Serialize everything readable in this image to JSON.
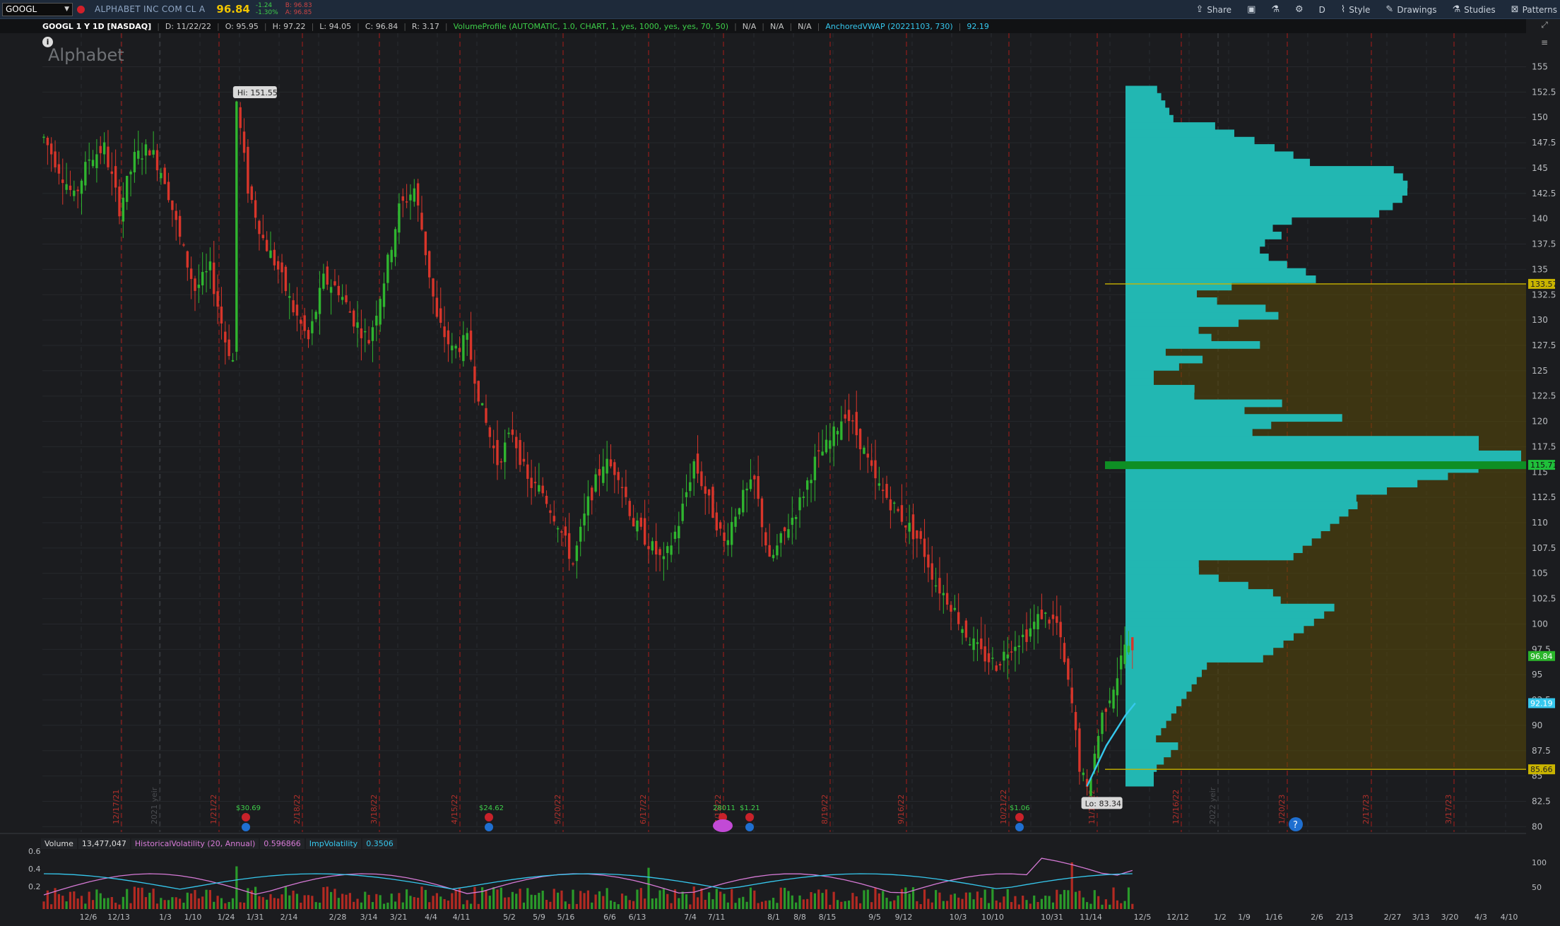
{
  "toolbar": {
    "symbol": "GOOGL",
    "company": "ALPHABET INC COM CL A",
    "last_price": "96.84",
    "change_abs": "-1.24",
    "change_pct": "-1.30%",
    "bid": "B: 96.83",
    "ask": "A: 96.85",
    "share_label": "Share",
    "aggregation_label": "D",
    "style_label": "Style",
    "drawings_label": "Drawings",
    "studies_label": "Studies",
    "patterns_label": "Patterns"
  },
  "status": {
    "symbol_line": "GOOGL 1 Y 1D [NASDAQ]",
    "date": "D: 11/22/22",
    "open": "O: 95.95",
    "high": "H: 97.22",
    "low": "L: 94.05",
    "close": "C: 96.84",
    "range": "R: 3.17",
    "volume_profile": "VolumeProfile (AUTOMATIC, 1.0, CHART, 1, yes, 1000, yes, yes, 70, 50)",
    "na1": "N/A",
    "na2": "N/A",
    "na3": "N/A",
    "anchored_vwap": "AnchoredVWAP (20221103, 730)",
    "anchored_vwap_value": "92.19"
  },
  "watermark": "Alphabet",
  "info_icon": "i",
  "colors": {
    "up": "#2fb52f",
    "down": "#d8352a",
    "profile": "#22b7b2",
    "poc": "#1fbf3a",
    "value_area": "#c9b400",
    "vwap": "#36c8ee",
    "last_badge": "#2bb52b"
  },
  "chart_data": {
    "type": "candlestick",
    "title": "GOOGL 1 Y 1D [NASDAQ]",
    "ylim": [
      81,
      156.5
    ],
    "y_ticks": [
      "155",
      "152.5",
      "150",
      "147.5",
      "145",
      "142.5",
      "140",
      "137.5",
      "135",
      "132.5",
      "130",
      "127.5",
      "125",
      "122.5",
      "120",
      "117.5",
      "115",
      "112.5",
      "110",
      "107.5",
      "105",
      "102.5",
      "100",
      "97.5",
      "95",
      "92.5",
      "90",
      "87.5",
      "85",
      "82.5",
      "80"
    ],
    "x_tick_labels": [
      "12/6",
      "12/13",
      "1/3",
      "1/10",
      "1/24",
      "1/31",
      "2/14",
      "2/28",
      "3/14",
      "3/21",
      "4/4",
      "4/11",
      "5/2",
      "5/9",
      "5/16",
      "6/6",
      "6/13",
      "7/4",
      "7/11",
      "8/1",
      "8/8",
      "8/15",
      "9/5",
      "9/12",
      "10/3",
      "10/10",
      "10/31",
      "11/14",
      "12/5",
      "12/12",
      "1/2",
      "1/9",
      "1/16",
      "2/6",
      "2/13",
      "2/27",
      "3/13",
      "3/20",
      "4/3",
      "4/10"
    ],
    "separator_labels": [
      "12/17/21",
      "2021 yeir",
      "1/21/22",
      "2/18/22",
      "3/18/22",
      "4/15/22",
      "5/20/22",
      "6/17/22",
      "7/15/22",
      "8/19/22",
      "9/16/22",
      "10/21/22",
      "11/18/22",
      "12/16/22",
      "2022 yeir",
      "1/20/23",
      "2/17/23",
      "3/17/23"
    ],
    "earnings_labels": [
      "$30.69",
      "$24.62",
      "28011",
      "$1.21",
      "$1.06"
    ],
    "price_points": [
      [
        0,
        148
      ],
      [
        4,
        145
      ],
      [
        8,
        142
      ],
      [
        12,
        146
      ],
      [
        16,
        147
      ],
      [
        20,
        141
      ],
      [
        24,
        146
      ],
      [
        28,
        147
      ],
      [
        32,
        144
      ],
      [
        36,
        138
      ],
      [
        40,
        133
      ],
      [
        44,
        135
      ],
      [
        48,
        128
      ],
      [
        50,
        126
      ],
      [
        51,
        151.55
      ],
      [
        54,
        143
      ],
      [
        58,
        138
      ],
      [
        62,
        135
      ],
      [
        66,
        131
      ],
      [
        70,
        128
      ],
      [
        74,
        134
      ],
      [
        78,
        133
      ],
      [
        82,
        130
      ],
      [
        86,
        128
      ],
      [
        90,
        134
      ],
      [
        94,
        141
      ],
      [
        98,
        143
      ],
      [
        100,
        139
      ],
      [
        104,
        130
      ],
      [
        108,
        127
      ],
      [
        112,
        128
      ],
      [
        116,
        121
      ],
      [
        120,
        116
      ],
      [
        124,
        119
      ],
      [
        128,
        114
      ],
      [
        132,
        113
      ],
      [
        136,
        110
      ],
      [
        140,
        106
      ],
      [
        144,
        112
      ],
      [
        148,
        116
      ],
      [
        152,
        115
      ],
      [
        156,
        110
      ],
      [
        160,
        108
      ],
      [
        164,
        106
      ],
      [
        168,
        110
      ],
      [
        172,
        116
      ],
      [
        176,
        112
      ],
      [
        180,
        108
      ],
      [
        184,
        112
      ],
      [
        188,
        114
      ],
      [
        192,
        106
      ],
      [
        196,
        109
      ],
      [
        200,
        112
      ],
      [
        204,
        116
      ],
      [
        208,
        118
      ],
      [
        212,
        121
      ],
      [
        216,
        118
      ],
      [
        220,
        114
      ],
      [
        224,
        112
      ],
      [
        228,
        110
      ],
      [
        232,
        108
      ],
      [
        236,
        104
      ],
      [
        240,
        102
      ],
      [
        244,
        99
      ],
      [
        248,
        97
      ],
      [
        252,
        96
      ],
      [
        256,
        98
      ],
      [
        260,
        99
      ],
      [
        264,
        101
      ],
      [
        268,
        100
      ],
      [
        272,
        92
      ],
      [
        274,
        86
      ],
      [
        276,
        83.34
      ],
      [
        280,
        91
      ],
      [
        284,
        95
      ],
      [
        286,
        98
      ],
      [
        288,
        96.84
      ]
    ],
    "hi_label": "Hi: 151.55",
    "lo_label": "Lo: 83.34",
    "volume_profile": {
      "value_area_high": "133.57",
      "poc": "115.71",
      "value_area_low": "85.66"
    },
    "last_price_badge": "96.84",
    "vwap_badge": "92.19",
    "vwap_values": [
      84,
      86,
      88,
      89.5,
      91,
      92.19
    ]
  },
  "lower": {
    "volume_label": "Volume",
    "volume_value": "13,477,047",
    "hv_label": "HistoricalVolatility (20, Annual)",
    "hv_value": "0.596866",
    "iv_label": "ImpVolatility",
    "iv_value": "0.3506",
    "left_ticks": [
      "0.6",
      "0.4",
      "0.2"
    ],
    "right_ticks": [
      "100",
      "50"
    ]
  }
}
